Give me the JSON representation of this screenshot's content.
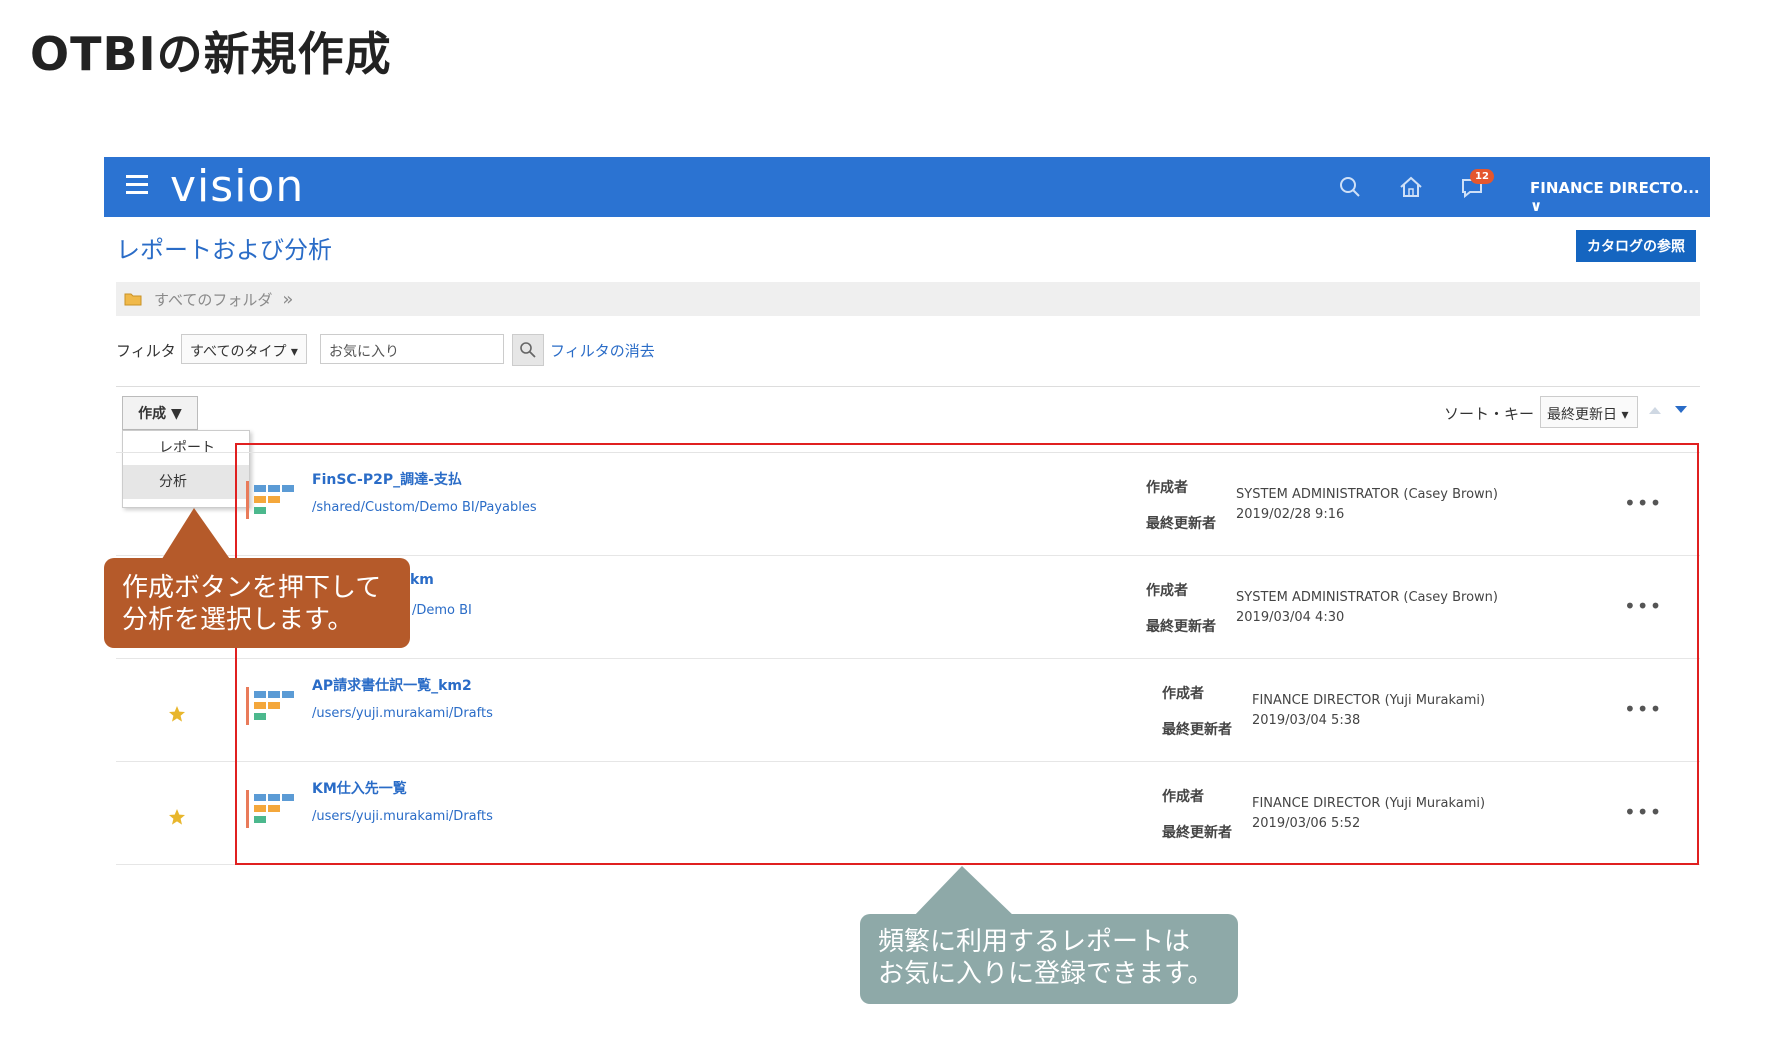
{
  "slide": {
    "title": "OTBIの新規作成"
  },
  "app": {
    "brand": "vision",
    "notification_count": "12",
    "user": "FINANCE DIRECTO... ∨",
    "colors": {
      "header": "#2b73d2",
      "link": "#2a6cc7",
      "button": "#1565c0"
    }
  },
  "page": {
    "title": "レポートおよび分析",
    "catalog_button": "カタログの参照"
  },
  "breadcrumb": {
    "folder": "すべてのフォルダ",
    "chevron": "»"
  },
  "filter": {
    "label": "フィルタ",
    "type_select": "すべてのタイプ ▾",
    "favorites_value": "お気に入り",
    "clear_link": "フィルタの消去"
  },
  "create": {
    "button": "作成 ▼",
    "menu": [
      "レポート",
      "分析"
    ]
  },
  "sort": {
    "label": "ソート・キー",
    "value": "最終更新日 ▾"
  },
  "labels": {
    "creator": "作成者",
    "updated_by": "最終更新者",
    "more": "•••"
  },
  "reports": [
    {
      "name": "FinSC-P2P_調達-支払",
      "path": "/shared/Custom/Demo BI/Payables",
      "creator": "SYSTEM ADMINISTRATOR (Casey Brown)",
      "updated": "2019/02/28 9:16",
      "favorite": false
    },
    {
      "name": "km",
      "path": "/Demo BI",
      "creator": "SYSTEM ADMINISTRATOR (Casey Brown)",
      "updated": "2019/03/04 4:30",
      "favorite": false
    },
    {
      "name": "AP請求書仕訳一覧_km2",
      "path": "/users/yuji.murakami/Drafts",
      "creator": "FINANCE DIRECTOR (Yuji Murakami)",
      "updated": "2019/03/04 5:38",
      "favorite": true
    },
    {
      "name": "KM仕入先一覧",
      "path": "/users/yuji.murakami/Drafts",
      "creator": "FINANCE DIRECTOR (Yuji Murakami)",
      "updated": "2019/03/06 5:52",
      "favorite": true
    }
  ],
  "callouts": {
    "left": [
      "作成ボタンを押下して",
      "分析を選択します。"
    ],
    "right": [
      "頻繁に利用するレポートは",
      "お気に入りに登録できます。"
    ]
  }
}
